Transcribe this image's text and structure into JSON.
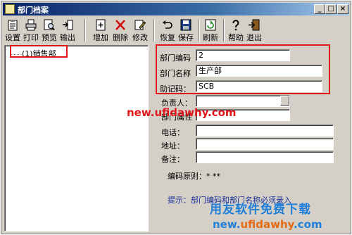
{
  "window": {
    "title": "部门档案",
    "min": "_",
    "max": "□",
    "close": "×"
  },
  "toolbar": [
    {
      "name": "settings",
      "label": "设置",
      "icon": "clipboard-icon"
    },
    {
      "name": "print",
      "label": "打印",
      "icon": "printer-icon"
    },
    {
      "name": "preview",
      "label": "预览",
      "icon": "preview-icon"
    },
    {
      "name": "export",
      "label": "输出",
      "icon": "export-icon"
    },
    {
      "name": "add",
      "label": "增加",
      "icon": "add-icon"
    },
    {
      "name": "delete",
      "label": "删除",
      "icon": "delete-icon"
    },
    {
      "name": "modify",
      "label": "修改",
      "icon": "edit-icon"
    },
    {
      "name": "restore",
      "label": "恢复",
      "icon": "undo-icon"
    },
    {
      "name": "save",
      "label": "保存",
      "icon": "save-icon"
    },
    {
      "name": "refresh",
      "label": "刷新",
      "icon": "refresh-icon"
    },
    {
      "name": "help",
      "label": "帮助",
      "icon": "help-icon"
    },
    {
      "name": "exit",
      "label": "退出",
      "icon": "exit-icon"
    }
  ],
  "tree": {
    "node": "(1)销售部"
  },
  "form": {
    "code_label": "部门编码",
    "code_value": "2",
    "name_label": "部门名称",
    "name_value": "生产部",
    "mnemonic_label": "助记码：",
    "mnemonic_value": "SCB",
    "manager_label": "负责人：",
    "manager_value": "",
    "attr_label": "部门属性",
    "attr_value": "",
    "phone_label": "电话：",
    "phone_value": "",
    "address_label": "地址：",
    "address_value": "",
    "note_label": "备注：",
    "note_value": "",
    "rule_label": "编码原则：* **",
    "hint_label": "提示：部门编码和部门名称必须录入"
  },
  "watermarks": {
    "url_red": "new.ufidawhy.com",
    "cn": "用友软件免费下载",
    "url_a": "new.",
    "url_b": "ufidawhy",
    "url_c": ".com"
  },
  "colors": {
    "titlebar": "#0a246a",
    "highlight": "#e0161c",
    "watermark_blue": "#1f7fd8",
    "watermark_orange": "#e56a12"
  }
}
